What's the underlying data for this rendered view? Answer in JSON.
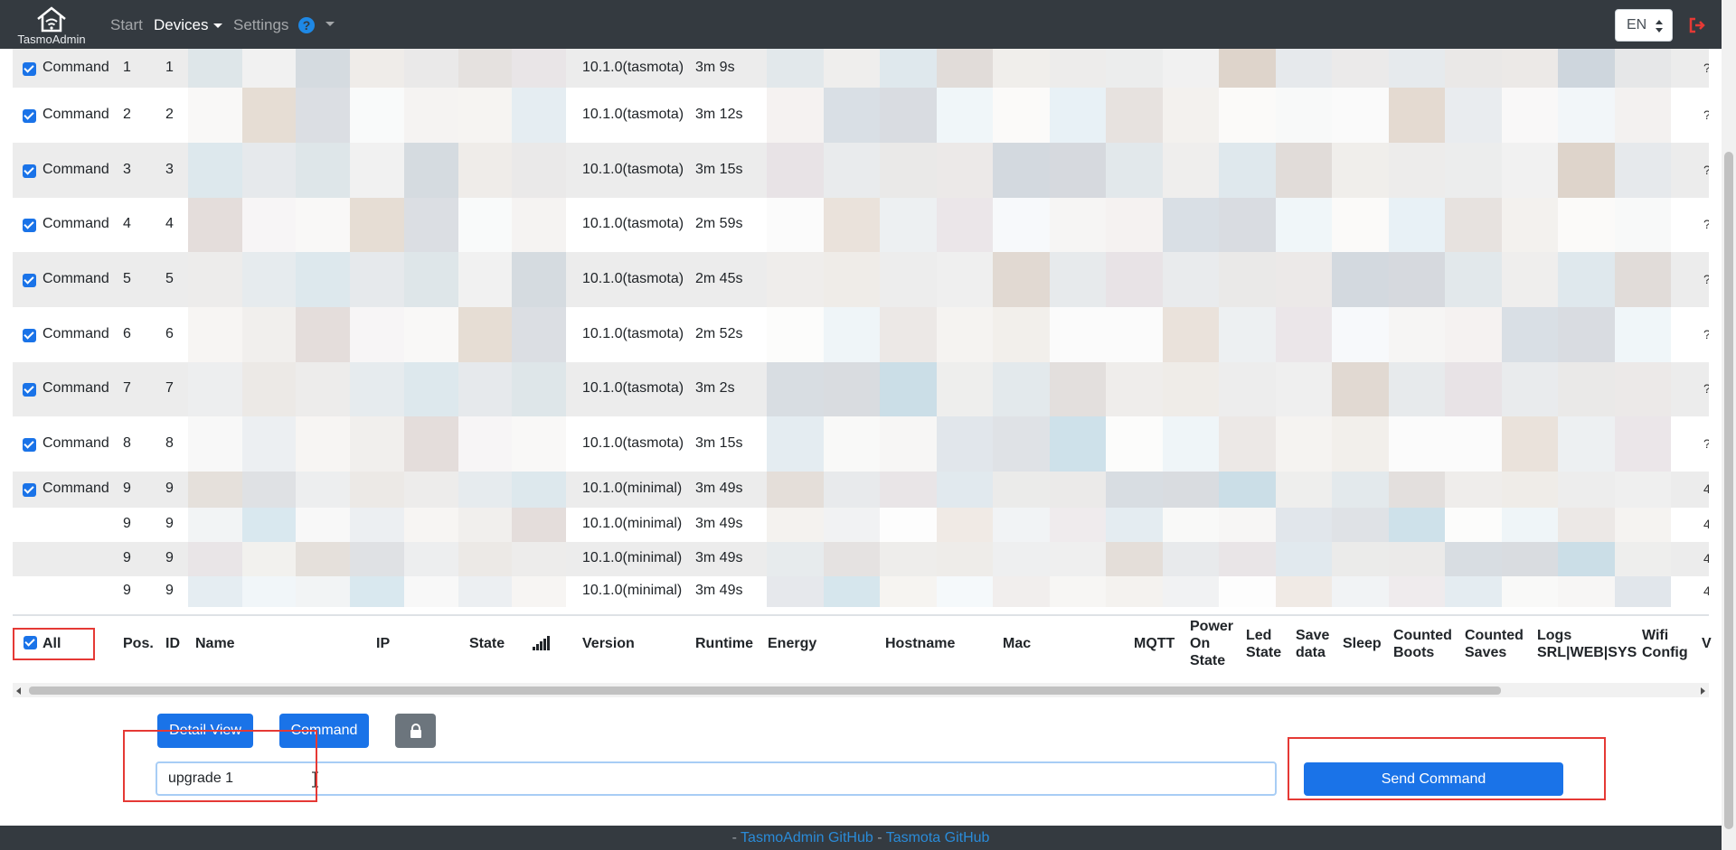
{
  "colors": {
    "navbar": "#343a40",
    "primary": "#1a73e8",
    "highlight": "#e53935",
    "link": "#2a8bd8"
  },
  "navbar": {
    "brand": "TasmoAdmin",
    "items": [
      {
        "label": "Start"
      },
      {
        "label": "Devices",
        "active": true,
        "dropdown": true
      },
      {
        "label": "Settings"
      }
    ],
    "help_icon": "question-circle-icon",
    "language": "EN",
    "logout_icon": "logout-icon"
  },
  "table": {
    "rows": [
      {
        "checked": true,
        "action": "Command",
        "pos": "1",
        "id": "1",
        "version": "10.1.0(tasmota)",
        "runtime": "3m 9s",
        "edge": "?"
      },
      {
        "checked": true,
        "action": "Command",
        "pos": "2",
        "id": "2",
        "version": "10.1.0(tasmota)",
        "runtime": "3m 12s",
        "edge": "?"
      },
      {
        "checked": true,
        "action": "Command",
        "pos": "3",
        "id": "3",
        "version": "10.1.0(tasmota)",
        "runtime": "3m 15s",
        "edge": "?"
      },
      {
        "checked": true,
        "action": "Command",
        "pos": "4",
        "id": "4",
        "version": "10.1.0(tasmota)",
        "runtime": "2m 59s",
        "edge": "?"
      },
      {
        "checked": true,
        "action": "Command",
        "pos": "5",
        "id": "5",
        "version": "10.1.0(tasmota)",
        "runtime": "2m 45s",
        "edge": "?"
      },
      {
        "checked": true,
        "action": "Command",
        "pos": "6",
        "id": "6",
        "version": "10.1.0(tasmota)",
        "runtime": "2m 52s",
        "edge": "?"
      },
      {
        "checked": true,
        "action": "Command",
        "pos": "7",
        "id": "7",
        "version": "10.1.0(tasmota)",
        "runtime": "3m 2s",
        "edge": "?"
      },
      {
        "checked": true,
        "action": "Command",
        "pos": "8",
        "id": "8",
        "version": "10.1.0(tasmota)",
        "runtime": "3m 15s",
        "edge": "?"
      },
      {
        "checked": true,
        "action": "Command",
        "pos": "9",
        "id": "9",
        "version": "10.1.0(minimal)",
        "runtime": "3m 49s",
        "edge": "4"
      },
      {
        "checked": false,
        "action": "",
        "pos": "9",
        "id": "9",
        "version": "10.1.0(minimal)",
        "runtime": "3m 49s",
        "edge": "4"
      },
      {
        "checked": false,
        "action": "",
        "pos": "9",
        "id": "9",
        "version": "10.1.0(minimal)",
        "runtime": "3m 49s",
        "edge": "4"
      },
      {
        "checked": false,
        "action": "",
        "pos": "9",
        "id": "9",
        "version": "10.1.0(minimal)",
        "runtime": "3m 49s",
        "edge": "4"
      }
    ],
    "headers": {
      "all": "All",
      "pos": "Pos.",
      "id": "ID",
      "name": "Name",
      "ip": "IP",
      "state": "State",
      "signal_icon": "signal-strength-icon",
      "version": "Version",
      "runtime": "Runtime",
      "energy": "Energy",
      "hostname": "Hostname",
      "mac": "Mac",
      "mqtt": "MQTT",
      "power_on_state": [
        "Power",
        "On",
        "State"
      ],
      "led_state": [
        "Led",
        "State"
      ],
      "save_data": [
        "Save",
        "data"
      ],
      "sleep": "Sleep",
      "counted_boots": [
        "Counted",
        "Boots"
      ],
      "counted_saves": [
        "Counted",
        "Saves"
      ],
      "logs": [
        "Logs",
        "SRL|WEB|SYS"
      ],
      "wifi_config": [
        "Wifi",
        "Config"
      ],
      "cut_off": "V"
    },
    "all_checked": true
  },
  "actions": {
    "detail_view": "Detail View",
    "command": "Command",
    "lock_icon": "lock-icon",
    "command_input_value": "upgrade 1",
    "send_command": "Send Command"
  },
  "footer": {
    "separator": "-",
    "link1": "TasmoAdmin GitHub",
    "link2": "Tasmota GitHub"
  }
}
